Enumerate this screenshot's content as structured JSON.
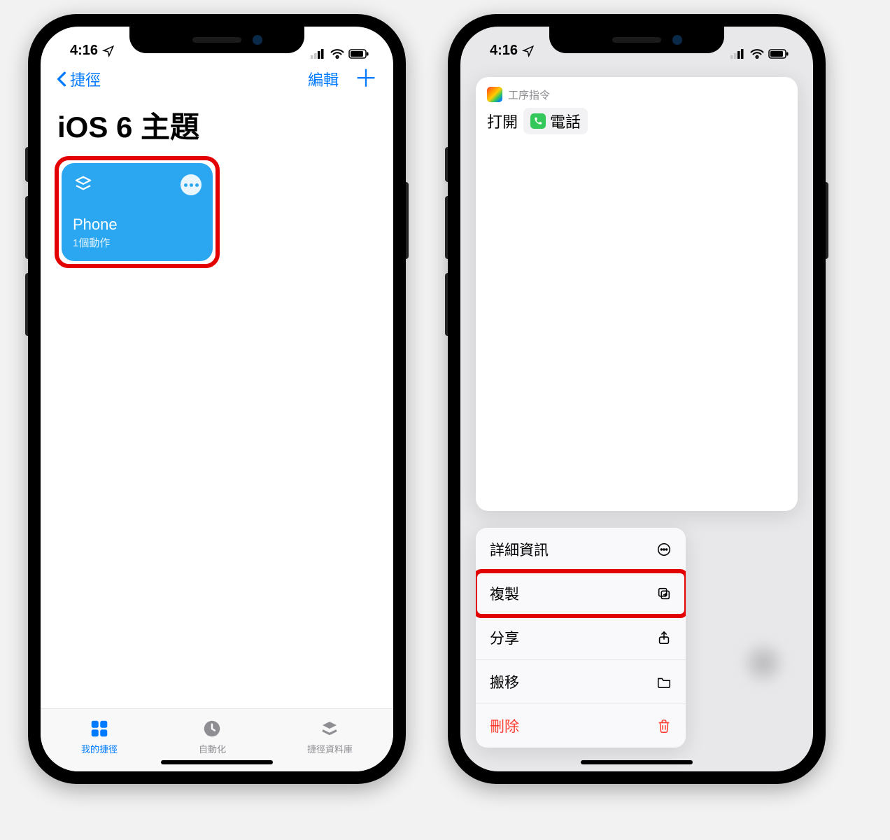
{
  "status": {
    "time": "4:16"
  },
  "screen1": {
    "nav": {
      "back": "捷徑",
      "edit": "編輯"
    },
    "title": "iOS 6 主題",
    "tile": {
      "name": "Phone",
      "sub": "1個動作"
    },
    "tabs": {
      "my": "我的捷徑",
      "auto": "自動化",
      "gallery": "捷徑資料庫"
    }
  },
  "screen2": {
    "preview": {
      "app_label": "工序指令",
      "open": "打開",
      "target": "電話"
    },
    "menu": {
      "details": "詳細資訊",
      "duplicate": "複製",
      "share": "分享",
      "move": "搬移",
      "delete": "刪除"
    }
  }
}
